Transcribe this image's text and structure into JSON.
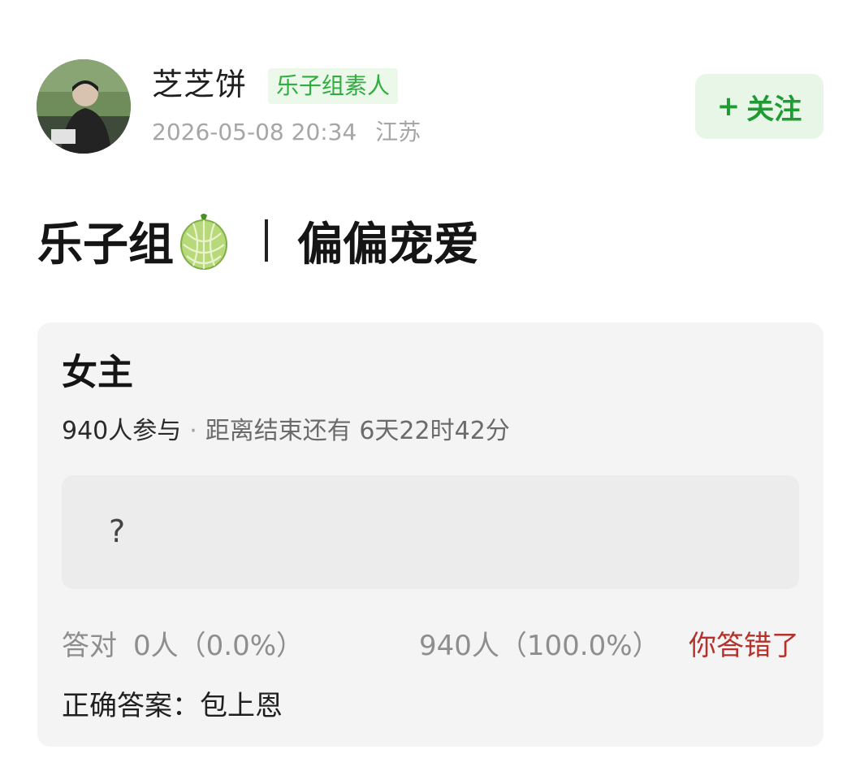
{
  "author": {
    "name": "芝芝饼",
    "badge": "乐子组素人",
    "timestamp": "2026-05-08 20:34",
    "location": "江苏"
  },
  "follow_button": {
    "plus": "+",
    "label": "关注"
  },
  "post": {
    "title_left": "乐子组",
    "title_emoji": "melon",
    "title_right": "偏偏宠爱"
  },
  "quiz": {
    "title": "女主",
    "participants": "940人参与",
    "separator": "·",
    "time_left": "距离结束还有 6天22时42分",
    "answer_placeholder": "?",
    "correct_label": "答对",
    "correct_stat": "0人（0.0%）",
    "wrong_stat": "940人（100.0%）",
    "result": "你答错了",
    "answer_line": "正确答案：包上恩"
  },
  "colors": {
    "badge_text": "#2fae3f",
    "badge_bg": "#ebf8ea",
    "follow_text": "#1f9b33",
    "follow_bg": "#e7f6e6",
    "wrong_text": "#b5322c",
    "card_bg": "#f4f4f4"
  }
}
